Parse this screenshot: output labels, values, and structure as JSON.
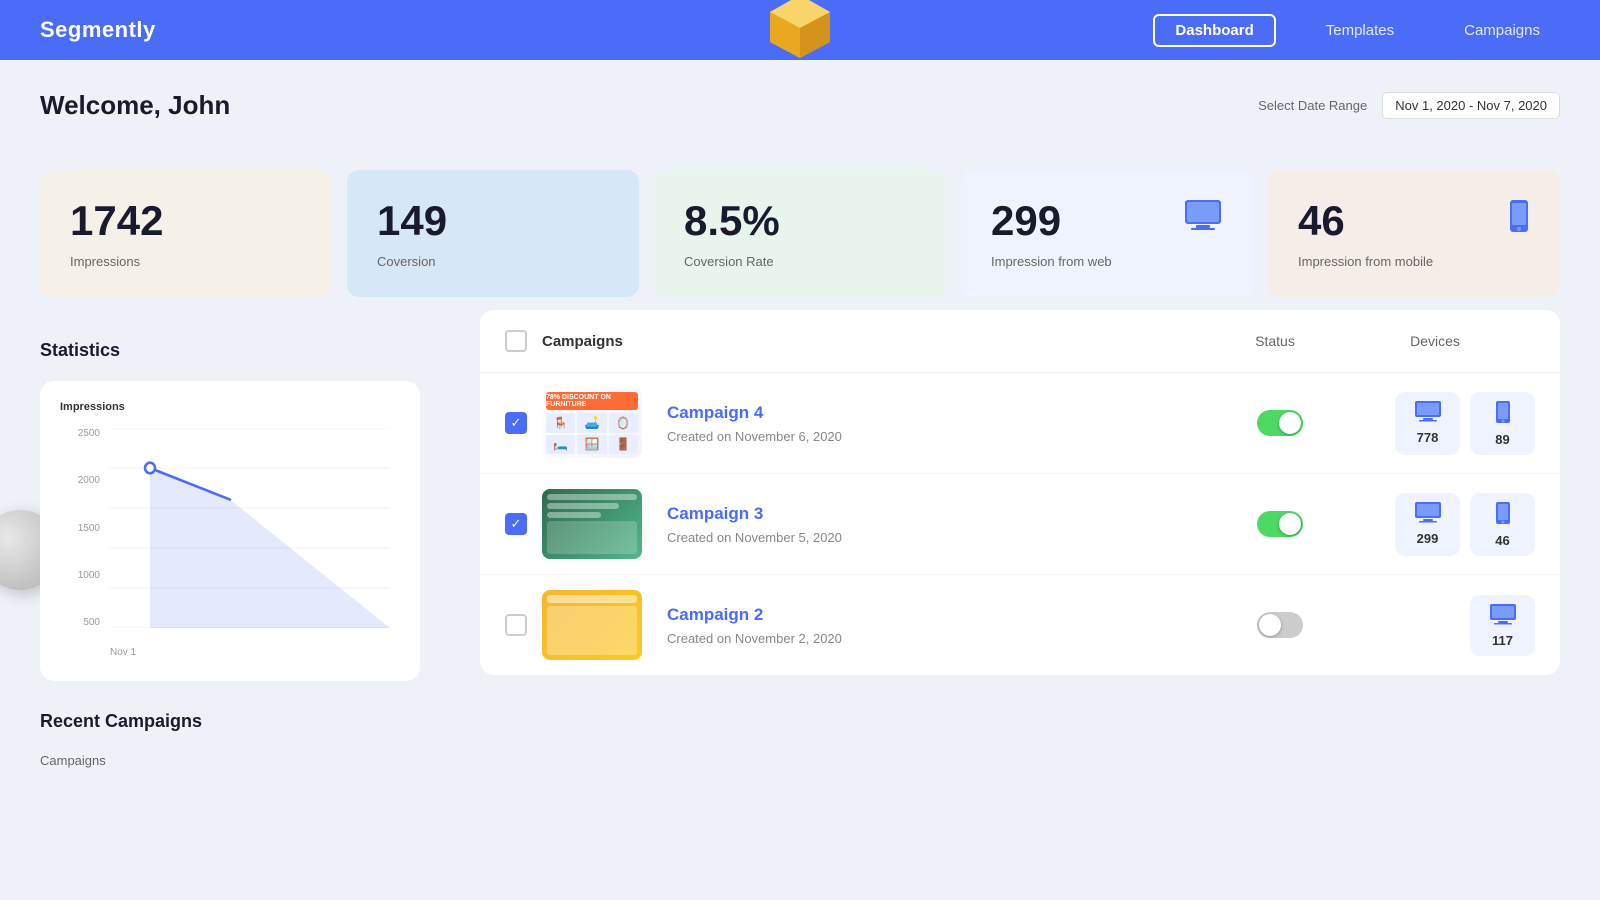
{
  "app": {
    "brand": "Segmently",
    "nav": {
      "links": [
        "Dashboard",
        "Templates",
        "Campaigns"
      ],
      "active": "Dashboard"
    }
  },
  "header": {
    "welcome": "Welcome, John",
    "date_range_label": "Select Date Range",
    "date_range_value": "Nov 1, 2020 - Nov 7, 2020"
  },
  "stat_cards": [
    {
      "id": "impressions",
      "number": "1742",
      "label": "Impressions",
      "style": "cream",
      "icon": null
    },
    {
      "id": "coversion",
      "number": "149",
      "label": "Coversion",
      "style": "light-blue",
      "icon": null
    },
    {
      "id": "coversion-rate",
      "number": "8.5%",
      "label": "Coversion Rate",
      "style": "light-green",
      "icon": null
    },
    {
      "id": "impression-web",
      "number": "299",
      "label": "Impression from web",
      "style": "white-blue",
      "icon": "monitor"
    },
    {
      "id": "impression-mobile",
      "number": "46",
      "label": "Impression from mobile",
      "style": "peach",
      "icon": "mobile"
    }
  ],
  "statistics": {
    "title": "Statistics",
    "chart": {
      "y_label": "Impressions",
      "y_ticks": [
        "2500",
        "2000",
        "1500",
        "1000",
        "500"
      ],
      "x_ticks": [
        "Nov 1"
      ],
      "bar_values": [
        2000,
        1700
      ]
    }
  },
  "recent_campaigns": {
    "title": "Recent Campaigns",
    "sub_label": "Campaigns"
  },
  "campaigns_table": {
    "header": {
      "title": "Campaigns",
      "status_label": "Status",
      "devices_label": "Devices"
    },
    "rows": [
      {
        "id": "campaign-4",
        "name": "Campaign 4",
        "date": "Created on November 6, 2020",
        "checked": true,
        "active": true,
        "web_count": "778",
        "mobile_count": "89",
        "thumb_style": "c4"
      },
      {
        "id": "campaign-3",
        "name": "Campaign 3",
        "date": "Created on November 5, 2020",
        "checked": true,
        "active": true,
        "web_count": "299",
        "mobile_count": "46",
        "thumb_style": "c3"
      },
      {
        "id": "campaign-2",
        "name": "Campaign 2",
        "date": "Created on November 2, 2020",
        "checked": false,
        "active": false,
        "web_count": "117",
        "mobile_count": null,
        "thumb_style": "c2"
      }
    ]
  }
}
